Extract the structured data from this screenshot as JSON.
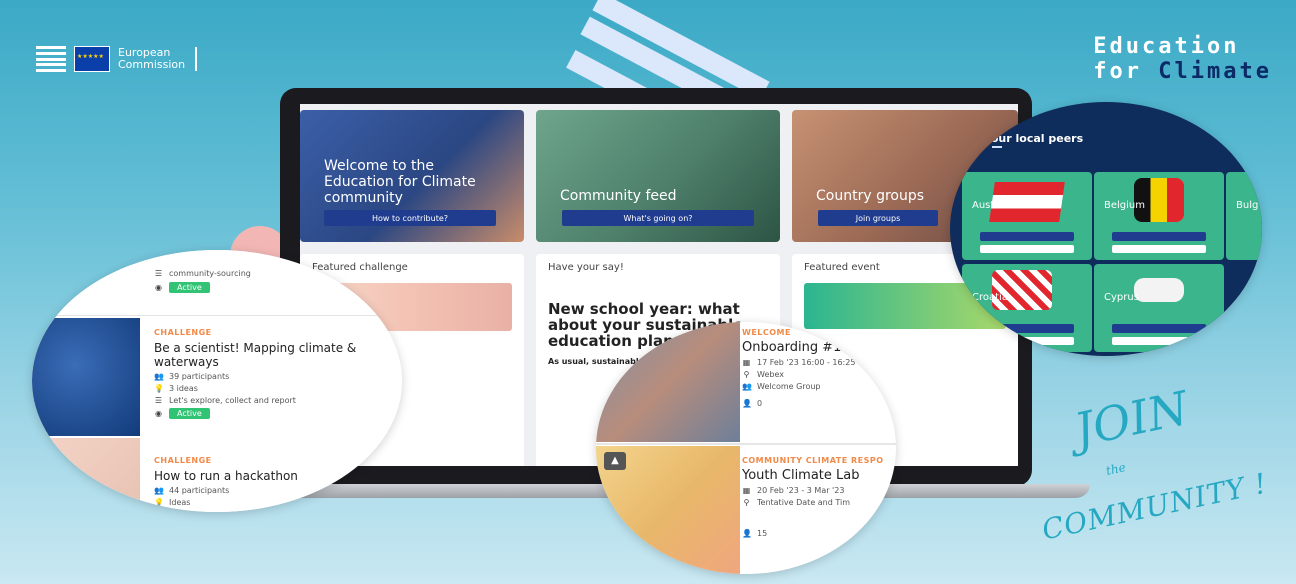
{
  "brand": {
    "org_line1": "European",
    "org_line2": "Commission",
    "title_line1": "Education",
    "title_for": "for",
    "title_climate": "Climate"
  },
  "hero": [
    {
      "title": "Welcome to the Education for Climate community",
      "button": "How to contribute?"
    },
    {
      "title": "Community feed",
      "button": "What's going on?"
    },
    {
      "title": "Country groups",
      "button": "Join groups"
    }
  ],
  "cards": {
    "featured_challenge": "Featured challenge",
    "have_your_say": "Have your say!",
    "have_your_say_big": "New school year: what about your sustainable education plans?",
    "have_your_say_small": "As usual, sustainable ... my priorities",
    "featured_event": "Featured event"
  },
  "left_circle": {
    "top_meta": "community-sourcing",
    "top_status": "Active",
    "challenge1": {
      "tag": "CHALLENGE",
      "title": "Be a scientist! Mapping climate & waterways",
      "participants": "39 participants",
      "ideas": "3 ideas",
      "summary": "Let's explore, collect and report",
      "status": "Active"
    },
    "challenge2": {
      "tag": "CHALLENGE",
      "title": "How to run a hackathon",
      "participants": "44 participants",
      "ideas": "Ideas"
    }
  },
  "bottom_circle": {
    "event1": {
      "tag": "WELCOME",
      "title": "Onboarding #1",
      "date": "17 Feb '23 16:00 - 16:25",
      "location": "Webex",
      "group": "Welcome Group",
      "count": "0"
    },
    "event2": {
      "tag": "COMMUNITY CLIMATE RESPO",
      "title": "Youth Climate Lab",
      "date": "20 Feb '23 - 3 Mar '23",
      "location": "Tentative Date and Tim",
      "count": "15"
    }
  },
  "right_circle": {
    "heading": "d your local peers",
    "countries": [
      "Austria",
      "Belgium",
      "Bulg",
      "Croatia",
      "Cyprus"
    ]
  },
  "join": {
    "line1": "JOIN",
    "line2": "the",
    "line3": "COMMUNITY !"
  },
  "colors": {
    "accent_blue": "#1f3c8f",
    "active_green": "#32c474",
    "tag_orange": "#f08a48",
    "join_teal": "#26a8c2"
  }
}
